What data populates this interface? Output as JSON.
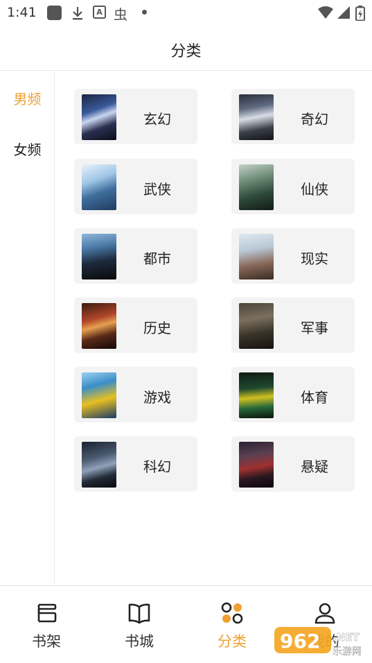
{
  "status_bar": {
    "time": "1:41",
    "icons": [
      "app-square-icon",
      "download-icon",
      "a-icon",
      "bug-icon",
      "dot-icon",
      "wifi-icon",
      "signal-icon",
      "battery-icon"
    ]
  },
  "header": {
    "title": "分类"
  },
  "sidebar": {
    "tabs": [
      {
        "label": "男频",
        "active": true
      },
      {
        "label": "女频",
        "active": false
      }
    ]
  },
  "categories": [
    {
      "label": "玄幻",
      "cover_text": ""
    },
    {
      "label": "奇幻",
      "cover_text": ""
    },
    {
      "label": "武侠",
      "cover_text": ""
    },
    {
      "label": "仙侠",
      "cover_text": ""
    },
    {
      "label": "都市",
      "cover_text": ""
    },
    {
      "label": "现实",
      "cover_text": ""
    },
    {
      "label": "历史",
      "cover_text": ""
    },
    {
      "label": "军事",
      "cover_text": ""
    },
    {
      "label": "游戏",
      "cover_text": ""
    },
    {
      "label": "体育",
      "cover_text": ""
    },
    {
      "label": "科幻",
      "cover_text": ""
    },
    {
      "label": "悬疑",
      "cover_text": ""
    }
  ],
  "bottom_nav": {
    "items": [
      {
        "label": "书架",
        "icon": "bookshelf-icon",
        "active": false
      },
      {
        "label": "书城",
        "icon": "open-book-icon",
        "active": false
      },
      {
        "label": "分类",
        "icon": "category-icon",
        "active": true
      },
      {
        "label": "我的",
        "icon": "user-icon",
        "active": false
      }
    ]
  },
  "watermark": {
    "text": "962.NET",
    "subtext": "乐游网"
  },
  "colors": {
    "accent": "#f0a030",
    "card_bg": "#f3f3f3",
    "text": "#222222"
  }
}
